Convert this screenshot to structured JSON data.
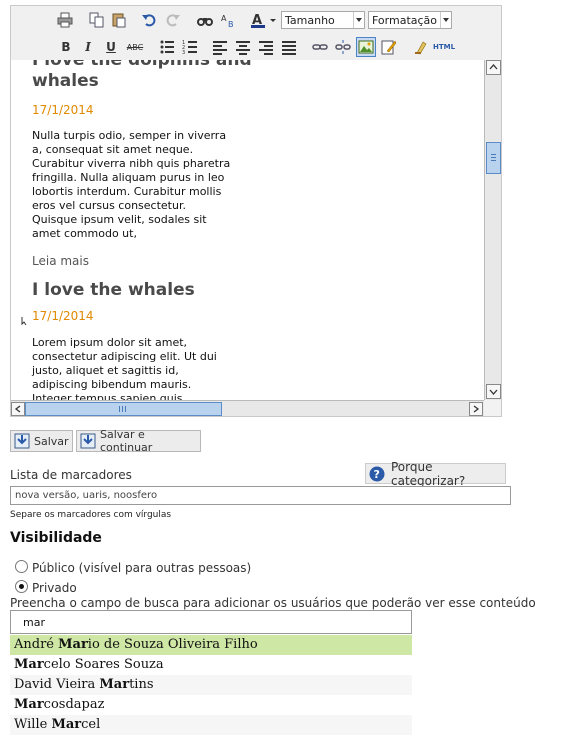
{
  "toolbar": {
    "font_size_select": "Tamanho",
    "format_select": "Formatação",
    "html_button": "HTML",
    "bold": "B",
    "italic": "I",
    "underline": "U",
    "strikethrough": "ABC"
  },
  "content": {
    "articles": [
      {
        "title": "I love the dolphins and whales",
        "date": "17/1/2014",
        "body": "Nulla turpis odio, semper in viverra a, consequat sit amet neque. Curabitur viverra nibh quis pharetra fringilla. Nulla aliquam purus in leo lobortis interdum. Curabitur mollis eros vel cursus consectetur. Quisque ipsum velit, sodales sit amet commodo ut,",
        "read_more": "Leia mais"
      },
      {
        "title": "I love the whales",
        "date": "17/1/2014",
        "body": "Lorem ipsum dolor sit amet, consectetur adipiscing elit. Ut dui justo, aliquet et sagittis id, adipiscing bibendum mauris. Integer tempus sapien quis"
      }
    ]
  },
  "actions": {
    "save": "Salvar",
    "save_continue": "Salvar e continuar"
  },
  "tags": {
    "label": "Lista de marcadores",
    "why_button": "Porque categorizar?",
    "value": "nova versão, uaris, noosfero",
    "hint": "Separe os marcadores com vírgulas"
  },
  "visibility": {
    "heading": "Visibilidade",
    "public_label": "Público (visível para outras pessoas)",
    "private_label": "Privado",
    "selected": "private",
    "search_hint": "Preencha o campo de busca para adicionar os usuários que poderão ver esse conteúdo",
    "search_value": "mar",
    "results": [
      {
        "pre": "André ",
        "match": "Mar",
        "post": "io de Souza Oliveira Filho"
      },
      {
        "pre": "",
        "match": "Mar",
        "post": "celo Soares Souza"
      },
      {
        "pre": "David Vieira ",
        "match": "Mar",
        "post": "tins"
      },
      {
        "pre": "",
        "match": "Mar",
        "post": "cosdapaz"
      },
      {
        "pre": "Wille ",
        "match": "Mar",
        "post": "cel"
      }
    ]
  },
  "colors": {
    "date": "#e08a00",
    "selected_result": "#cfe7a5",
    "scroll_thumb": "#b9d2ee"
  }
}
